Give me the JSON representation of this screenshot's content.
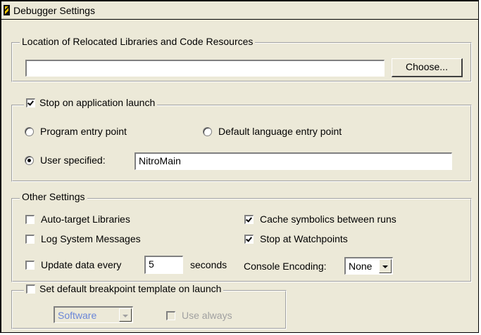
{
  "window": {
    "title": "Debugger Settings"
  },
  "location": {
    "legend": "Location of Relocated Libraries and Code Resources",
    "path_value": "",
    "choose_label": "Choose..."
  },
  "launch": {
    "legend": "Stop on application launch",
    "checked": true,
    "program_entry": "Program entry point",
    "default_language_entry": "Default language entry point",
    "user_specified": "User specified:",
    "user_specified_value": "NitroMain",
    "selected": "user_specified"
  },
  "other": {
    "legend": "Other Settings",
    "auto_target": "Auto-target Libraries",
    "log_system": "Log System Messages",
    "update_data": "Update data every",
    "update_value": "5",
    "seconds": "seconds",
    "cache_symbolics": "Cache symbolics between runs",
    "stop_watchpoints": "Stop at Watchpoints",
    "console_encoding": "Console Encoding:",
    "console_encoding_value": "None"
  },
  "breakpoint": {
    "legend": "Set default breakpoint template on launch",
    "template_value": "Software",
    "use_always": "Use always"
  }
}
